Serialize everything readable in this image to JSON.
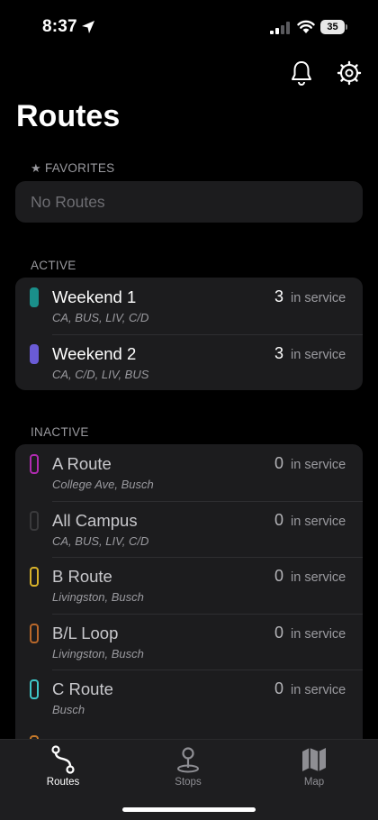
{
  "status": {
    "time": "8:37",
    "battery": "35"
  },
  "header": {
    "title": "Routes"
  },
  "favorites": {
    "label": "FAVORITES",
    "empty_text": "No Routes"
  },
  "active": {
    "label": "ACTIVE",
    "routes": [
      {
        "name": "Weekend 1",
        "stops": "CA, BUS, LIV, C/D",
        "count": "3",
        "status": "in service",
        "color": "#1a8f8a"
      },
      {
        "name": "Weekend 2",
        "stops": "CA, C/D, LIV, BUS",
        "count": "3",
        "status": "in service",
        "color": "#6a5bd6"
      }
    ]
  },
  "inactive": {
    "label": "INACTIVE",
    "routes": [
      {
        "name": "A Route",
        "stops": "College Ave, Busch",
        "count": "0",
        "status": "in service",
        "color": "#b02bb0"
      },
      {
        "name": "All Campus",
        "stops": "CA, BUS, LIV, C/D",
        "count": "0",
        "status": "in service",
        "color": "#3a3a3c"
      },
      {
        "name": "B Route",
        "stops": "Livingston, Busch",
        "count": "0",
        "status": "in service",
        "color": "#d8b22a"
      },
      {
        "name": "B/L Loop",
        "stops": "Livingston, Busch",
        "count": "0",
        "status": "in service",
        "color": "#b8672a"
      },
      {
        "name": "C Route",
        "stops": "Busch",
        "count": "0",
        "status": "in service",
        "color": "#3fc7c9"
      }
    ]
  },
  "tabs": [
    {
      "label": "Routes",
      "icon": "route-icon",
      "active": true
    },
    {
      "label": "Stops",
      "icon": "pin-icon",
      "active": false
    },
    {
      "label": "Map",
      "icon": "map-icon",
      "active": false
    }
  ]
}
